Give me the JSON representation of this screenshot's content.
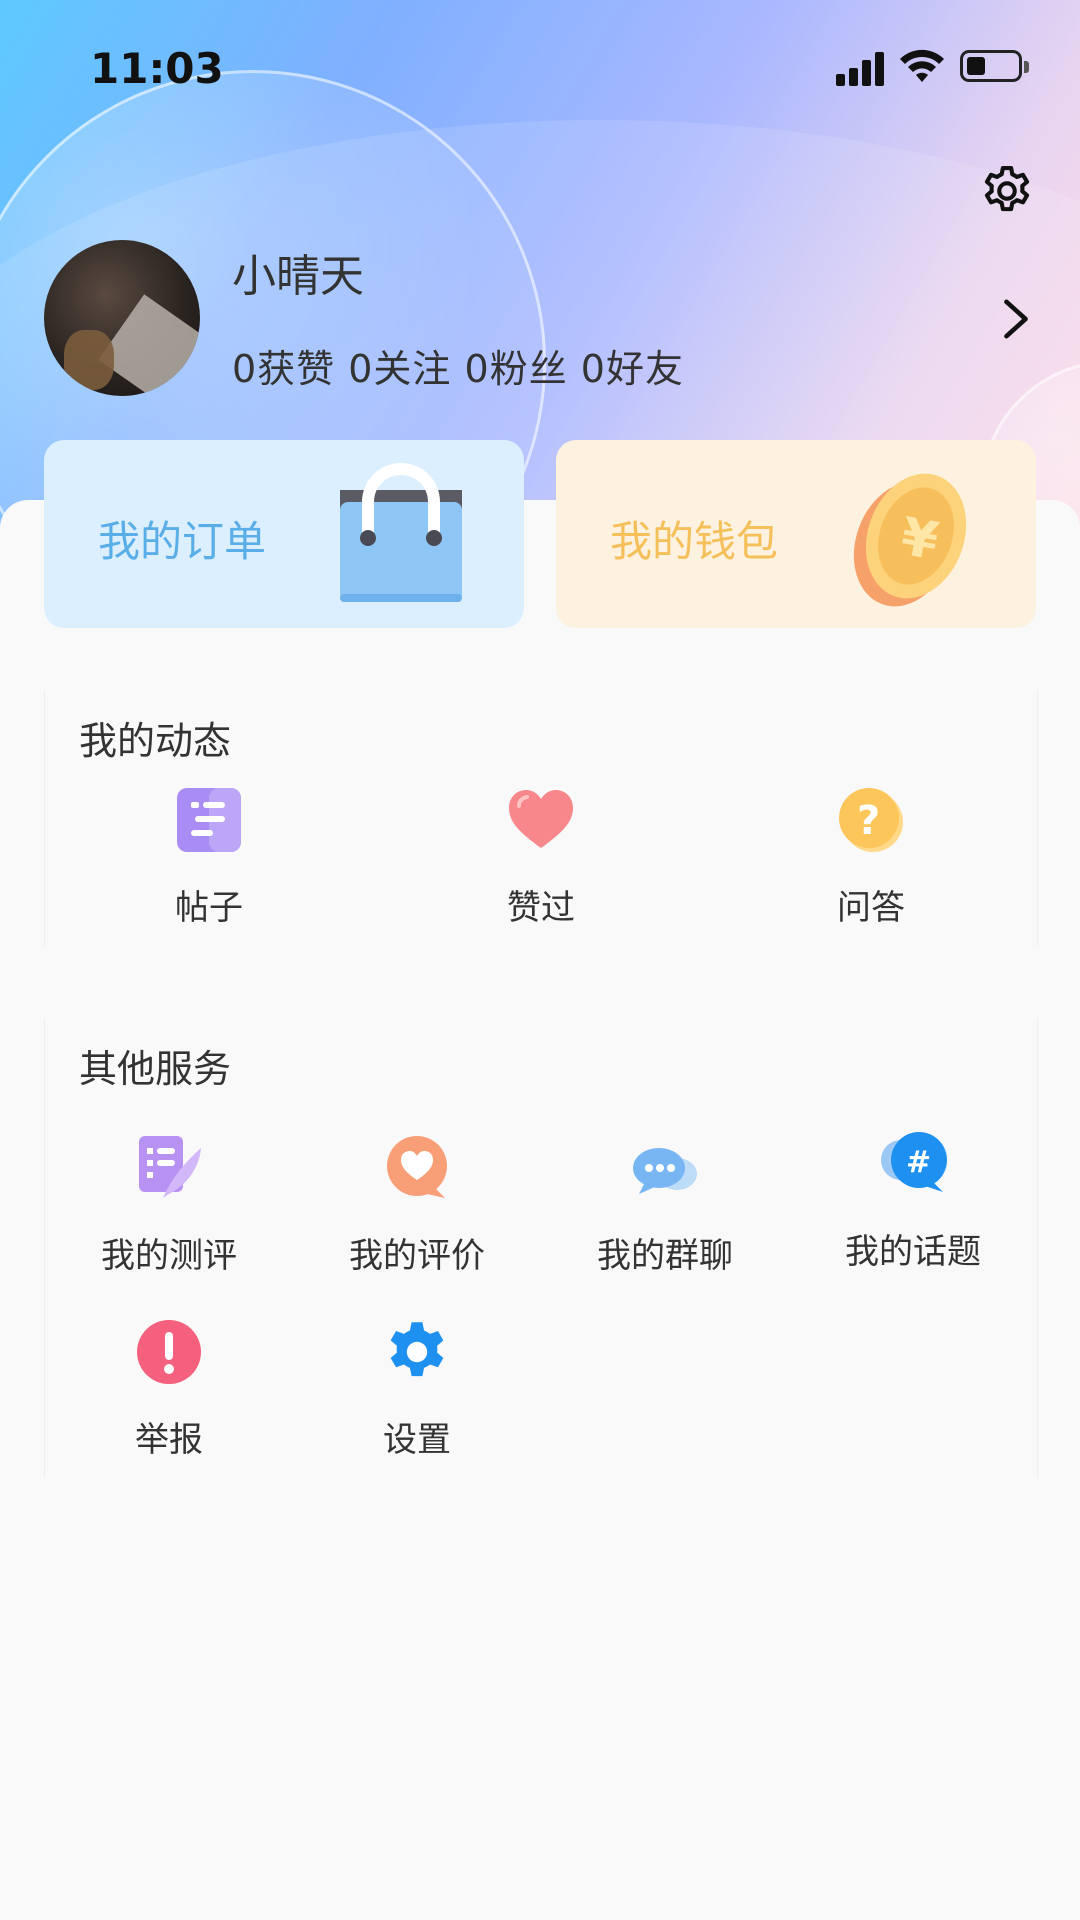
{
  "status_bar": {
    "time": "11:03"
  },
  "profile": {
    "name": "小晴天",
    "stats": "0获赞 0关注 0粉丝 0好友"
  },
  "cards": {
    "orders": {
      "label": "我的订单",
      "icon": "shopping-bag-icon",
      "color": "#5aaee8"
    },
    "wallet": {
      "label": "我的钱包",
      "icon": "coin-icon",
      "color": "#f5c05a"
    }
  },
  "activity": {
    "title": "我的动态",
    "items": [
      {
        "label": "帖子",
        "icon": "post-icon"
      },
      {
        "label": "赞过",
        "icon": "heart-icon"
      },
      {
        "label": "问答",
        "icon": "question-icon"
      }
    ]
  },
  "services": {
    "title": "其他服务",
    "items": [
      {
        "label": "我的测评",
        "icon": "review-quill-icon"
      },
      {
        "label": "我的评价",
        "icon": "rating-heart-bubble-icon"
      },
      {
        "label": "我的群聊",
        "icon": "group-chat-icon"
      },
      {
        "label": "我的话题",
        "icon": "topic-hash-icon"
      },
      {
        "label": "举报",
        "icon": "report-icon"
      },
      {
        "label": "设置",
        "icon": "settings-gear-icon"
      }
    ]
  }
}
